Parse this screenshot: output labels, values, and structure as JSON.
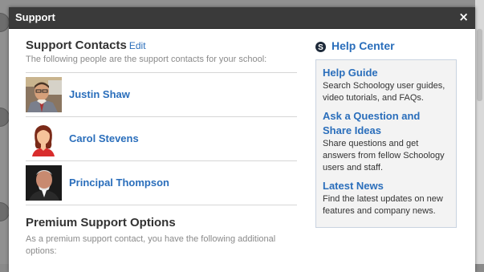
{
  "dialog": {
    "title": "Support",
    "close_symbol": "×"
  },
  "support_contacts": {
    "heading": "Support Contacts",
    "edit_label": "Edit",
    "description": "The following people are the support contacts for your school:",
    "contacts": [
      {
        "name": "Justin Shaw",
        "avatar": "photo-man-glasses"
      },
      {
        "name": "Carol Stevens",
        "avatar": "default-female-avatar"
      },
      {
        "name": "Principal Thompson",
        "avatar": "photo-man-dark-suit"
      }
    ]
  },
  "premium": {
    "heading": "Premium Support Options",
    "description": "As a premium support contact, you have the following additional options:"
  },
  "help_center": {
    "icon": "schoology-s-icon",
    "title": "Help Center",
    "items": [
      {
        "title": "Help Guide",
        "description": "Search Schoology user guides, video tutorials, and FAQs."
      },
      {
        "title": "Ask a Question and Share Ideas",
        "description": "Share questions and get answers from fellow Schoology users and staff."
      },
      {
        "title": "Latest News",
        "description": "Find the latest updates on new features and company news."
      }
    ]
  },
  "colors": {
    "link": "#2a6ebb",
    "titlebar": "#3a3a3a",
    "help_box_bg": "#f3f3f3"
  }
}
